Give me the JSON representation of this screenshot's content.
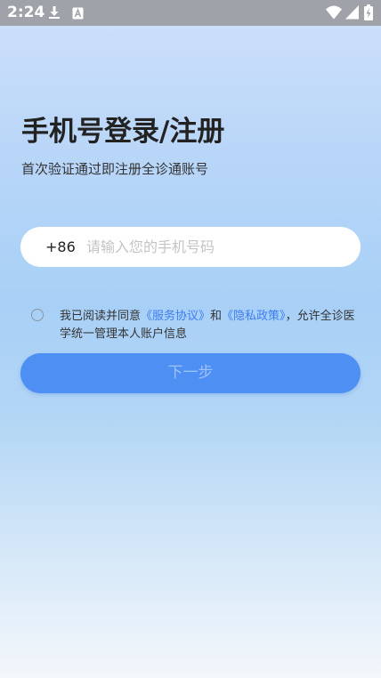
{
  "status_bar": {
    "time": "2:24",
    "icons": [
      "download-icon",
      "keyboard-a-icon",
      "wifi-icon",
      "signal-icon",
      "battery-charging-icon"
    ]
  },
  "login": {
    "title": "手机号登录/注册",
    "subtitle": "首次验证通过即注册全诊通账号",
    "country_code": "+86",
    "phone_placeholder": "请输入您的手机号码",
    "phone_value": "",
    "agreement": {
      "checked": false,
      "prefix": "我已阅读并同意",
      "service_link": "《服务协议》",
      "and": "和",
      "privacy_link": "《隐私政策》",
      "suffix": "，允许全诊医学统一管理本人账户信息"
    },
    "next_button": "下一步"
  },
  "colors": {
    "accent": "#4d8ff3",
    "link": "#3d7ef0",
    "status_bar": "#9fa3a9"
  }
}
